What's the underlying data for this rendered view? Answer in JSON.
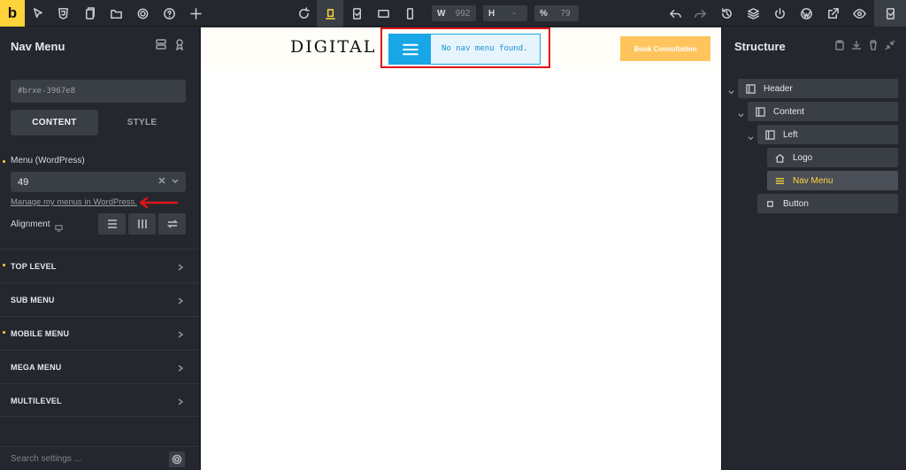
{
  "toolbar": {
    "brand": "b",
    "width_label": "W",
    "width_value": "992",
    "height_label": "H",
    "height_value": "-",
    "zoom_label": "%",
    "zoom_value": "79"
  },
  "left_panel": {
    "title": "Nav Menu",
    "element_id": "#brxe-3967e8",
    "tabs": {
      "content": "CONTENT",
      "style": "STYLE"
    },
    "menu_label": "Menu (WordPress)",
    "menu_value": "49",
    "manage_link": "Manage my menus in WordPress.",
    "alignment_label": "Alignment",
    "sections": [
      {
        "label": "TOP LEVEL",
        "dot": true
      },
      {
        "label": "SUB MENU",
        "dot": false
      },
      {
        "label": "MOBILE MENU",
        "dot": true
      },
      {
        "label": "MEGA MENU",
        "dot": false
      },
      {
        "label": "MULTILEVEL",
        "dot": false
      }
    ],
    "search_placeholder": "Search settings ..."
  },
  "canvas": {
    "logo_text": "DIGITAL",
    "nav_message": "No nav menu found.",
    "button_text": "Book Consultation"
  },
  "right_panel": {
    "title": "Structure",
    "tree": [
      {
        "label": "Header",
        "icon": "section-icon"
      },
      {
        "label": "Content",
        "icon": "section-icon"
      },
      {
        "label": "Left",
        "icon": "section-icon"
      },
      {
        "label": "Logo",
        "icon": "home-icon"
      },
      {
        "label": "Nav Menu",
        "icon": "menu-icon"
      },
      {
        "label": "Button",
        "icon": "square-icon"
      }
    ]
  },
  "colors": {
    "accent": "#ffd43b",
    "panel_bg": "#24272d",
    "control_bg": "#3a3e45",
    "highlight_red": "#e0131a",
    "nav_blue": "#18a6e6",
    "button_orange": "#ffc45c"
  }
}
